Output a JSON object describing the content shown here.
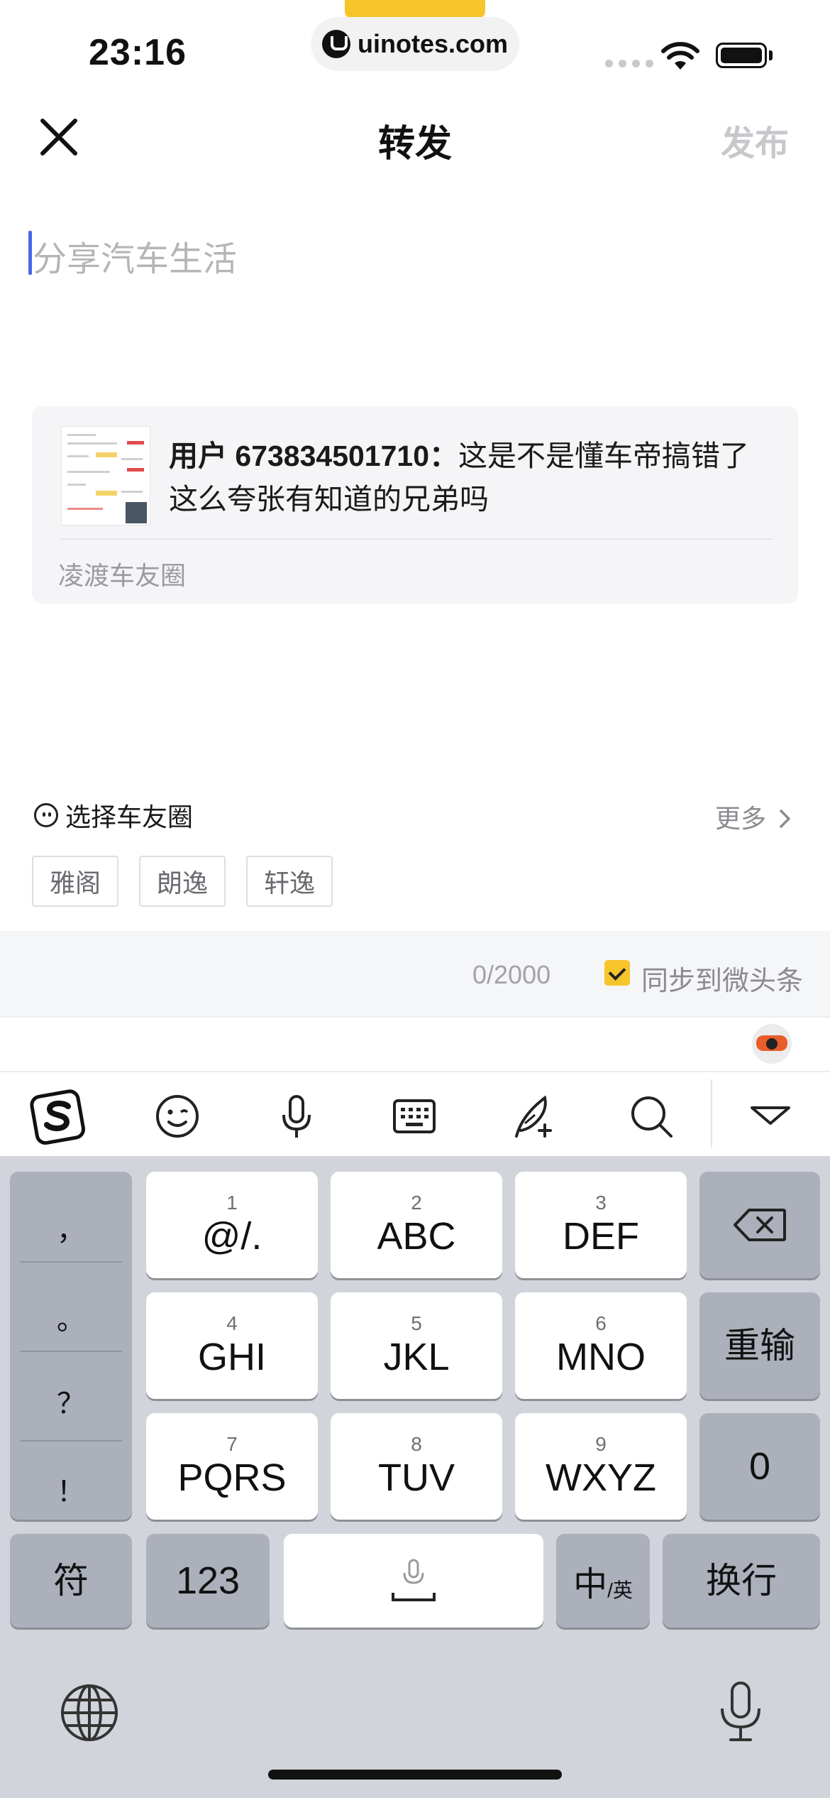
{
  "status_bar": {
    "time": "23:16",
    "url": "uinotes.com"
  },
  "nav": {
    "title": "转发",
    "publish": "发布"
  },
  "compose": {
    "placeholder": "分享汽车生活"
  },
  "quoted": {
    "user": "用户 673834501710",
    "sep": "：",
    "text": "这是不是懂车帝搞错了  这么夸张有知道的兄弟吗",
    "circle": "凌渡车友圈"
  },
  "circle_select": {
    "label": "选择车友圈",
    "more": "更多",
    "tags": [
      "雅阁",
      "朗逸",
      "轩逸"
    ]
  },
  "footer": {
    "count": "0/2000",
    "sync_label": "同步到微头条",
    "sync_checked": true
  },
  "keyboard": {
    "punct": [
      "，",
      "。",
      "？",
      "！"
    ],
    "keys": [
      {
        "num": "1",
        "main": "@/."
      },
      {
        "num": "2",
        "main": "ABC"
      },
      {
        "num": "3",
        "main": "DEF"
      },
      {
        "num": "4",
        "main": "GHI"
      },
      {
        "num": "5",
        "main": "JKL"
      },
      {
        "num": "6",
        "main": "MNO"
      },
      {
        "num": "7",
        "main": "PQRS"
      },
      {
        "num": "8",
        "main": "TUV"
      },
      {
        "num": "9",
        "main": "WXYZ"
      }
    ],
    "reenter": "重输",
    "zero": "0",
    "symbols": "符",
    "num_mode": "123",
    "lang_main": "中",
    "lang_sub": "/英",
    "enter": "换行"
  },
  "colors": {
    "accent": "#f6c52a",
    "caret": "#4a66e8",
    "publish_disabled": "#c7c7cc"
  }
}
